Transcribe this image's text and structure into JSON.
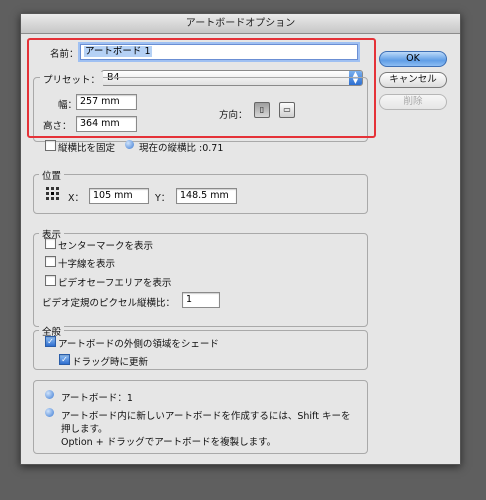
{
  "dialog": {
    "title": "アートボードオプション"
  },
  "name_label": "名前：",
  "name_value": "アートボード 1",
  "preset": {
    "label": "プリセット：",
    "value": "B4"
  },
  "width": {
    "label": "幅：",
    "value": "257 mm"
  },
  "height": {
    "label": "高さ：",
    "value": "364 mm"
  },
  "orientation": {
    "label": "方向：",
    "portrait_icon": "portrait-orientation-icon",
    "landscape_icon": "landscape-orientation-icon"
  },
  "constrain": {
    "label": "縦横比を固定",
    "checked": false,
    "ratio_text": "現在の縦横比 :0.71"
  },
  "buttons": {
    "ok": "OK",
    "cancel": "キャンセル",
    "delete": "削除"
  },
  "position": {
    "title": "位置",
    "x_label": "X：",
    "x_value": "105 mm",
    "y_label": "Y：",
    "y_value": "148.5 mm"
  },
  "display": {
    "title": "表示",
    "center_mark": "センターマークを表示",
    "cross_hairs": "十字線を表示",
    "video_safe": "ビデオセーフエリアを表示",
    "pixel_ratio_label": "ビデオ定規のピクセル縦横比：",
    "pixel_ratio_value": "1"
  },
  "global": {
    "title": "全般",
    "fade_outside": "アートボードの外側の領域をシェード",
    "update_drag": "ドラッグ時に更新"
  },
  "info": {
    "artboard_count": "アートボード：1",
    "tip_line1": "アートボード内に新しいアートボードを作成するには、Shift キーを",
    "tip_line2": "押します。",
    "tip_line3": "Option + ドラッグでアートボードを複製します。"
  },
  "colors": {
    "accent": "#3c7ad3",
    "highlight_box": "#e53238"
  }
}
